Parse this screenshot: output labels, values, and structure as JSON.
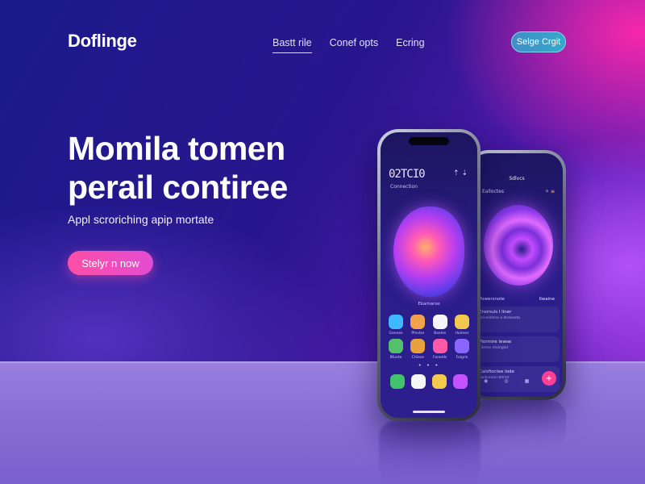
{
  "brand": {
    "name": "Doflinge"
  },
  "nav": {
    "items": [
      {
        "label": "Bastt rile",
        "active": true
      },
      {
        "label": "Conef opts",
        "active": false
      },
      {
        "label": "Ecring",
        "active": false
      }
    ],
    "cta_label": "Selge Crgit"
  },
  "hero": {
    "title_line1": "Momila tomen",
    "title_line2": "perail contiree",
    "subtitle": "Appl scroriching apip mortate",
    "cta_label": "Stelyr n now"
  },
  "front_phone": {
    "clock": "02TCI0",
    "clock_sub": "Connection",
    "status": "⇡ ⇣",
    "blob_label": "Ekamarse",
    "app_row1": [
      {
        "label": "Gannes",
        "color": "#3fb8ff"
      },
      {
        "label": "Phivlse",
        "color": "#f3a24b"
      },
      {
        "label": "Boelse",
        "color": "#f5f5f5"
      },
      {
        "label": "Hoimes",
        "color": "#f2c94c"
      }
    ],
    "app_row2": [
      {
        "label": "Bfuote",
        "color": "#53c06b"
      },
      {
        "label": "Ctiiese",
        "color": "#e8a13c"
      },
      {
        "label": "Fonelds",
        "color": "#ff5aa7"
      },
      {
        "label": "Folgris",
        "color": "#8a66ff"
      }
    ],
    "dots": "• • •",
    "dock": [
      {
        "name": "phone",
        "color": "#42c26a"
      },
      {
        "name": "messages",
        "color": "#f5f5f5"
      },
      {
        "name": "files",
        "color": "#f2c94c"
      },
      {
        "name": "media",
        "color": "#c452ff"
      }
    ],
    "accent": "#ff58b8"
  },
  "back_phone": {
    "title": "Sdlvcs",
    "sub": "Ealloctes",
    "badge": "⚪ ≡",
    "list_head_left": "Powersnote",
    "list_head_right": "Ilwaine",
    "items": [
      {
        "title": "Ensmuls I liner",
        "sub": "Aricelitisne a dnasesto"
      },
      {
        "title": "Plormire lewse",
        "sub": "Tileme ntoinglol"
      },
      {
        "title": "Calsfioctee lode",
        "sub": "Fonlsnnon bitrsd"
      }
    ],
    "tabs": [
      "◉",
      "◎",
      "▦",
      "▣"
    ],
    "fab": "+"
  }
}
